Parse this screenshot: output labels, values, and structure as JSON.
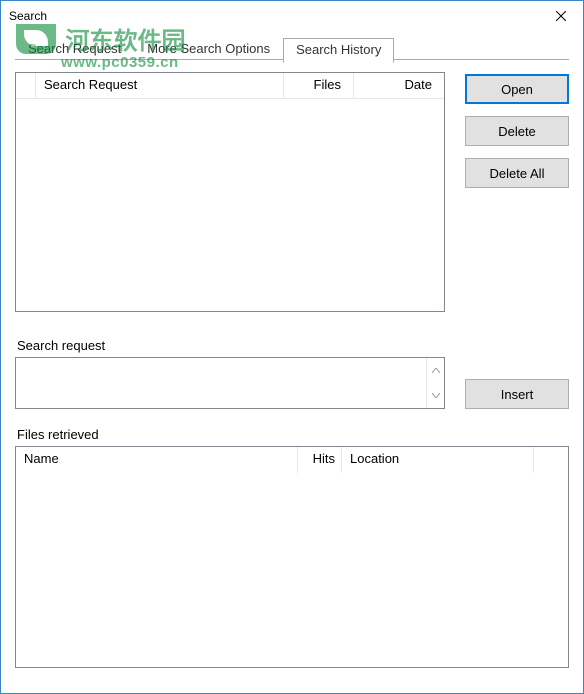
{
  "window": {
    "title": "Search"
  },
  "watermark": {
    "cn": "河东软件园",
    "url": "www.pc0359.cn"
  },
  "tabs": {
    "items": [
      {
        "label": "Search Request"
      },
      {
        "label": "More Search Options"
      },
      {
        "label": "Search History"
      }
    ],
    "active_index": 2
  },
  "history_table": {
    "columns": {
      "request": "Search Request",
      "files": "Files",
      "date": "Date"
    }
  },
  "buttons": {
    "open": "Open",
    "delete": "Delete",
    "delete_all": "Delete All",
    "insert": "Insert"
  },
  "labels": {
    "search_request": "Search request",
    "files_retrieved": "Files retrieved"
  },
  "files_table": {
    "columns": {
      "name": "Name",
      "hits": "Hits",
      "location": "Location"
    }
  }
}
